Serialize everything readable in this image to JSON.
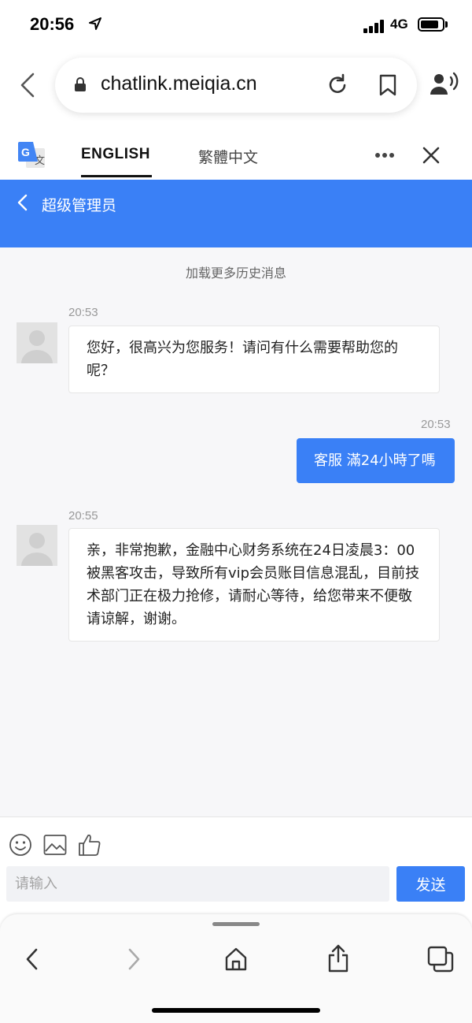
{
  "status_bar": {
    "time": "20:56",
    "network": "4G",
    "icons": [
      "location-arrow-icon",
      "signal-icon",
      "battery-icon"
    ]
  },
  "browser": {
    "url": "chatlink.meiqia.cn",
    "icons": [
      "back-icon",
      "lock-icon",
      "reload-icon",
      "bookmark-icon",
      "reader-voice-icon"
    ]
  },
  "translate_bar": {
    "tabs": [
      {
        "label": "ENGLISH",
        "active": true
      },
      {
        "label": "繁體中文",
        "active": false
      }
    ],
    "icons": [
      "google-translate-icon",
      "more-icon",
      "close-icon"
    ]
  },
  "chat_header": {
    "title": "超级管理员",
    "background": "#3a80f6"
  },
  "chat": {
    "load_more": "加载更多历史消息",
    "messages": [
      {
        "direction": "in",
        "time": "20:53",
        "text": "您好，很高兴为您服务！请问有什么需要帮助您的呢？"
      },
      {
        "direction": "out",
        "time": "20:53",
        "text": "客服 滿24小時了嗎"
      },
      {
        "direction": "in",
        "time": "20:55",
        "text": "亲，非常抱歉，金融中心财务系统在24日凌晨3：00被黑客攻击，导致所有vip会员账目信息混乱，目前技术部门正在极力抢修，请耐心等待，给您带来不便敬请谅解，谢谢。"
      }
    ]
  },
  "composer": {
    "placeholder": "请输入",
    "send_label": "发送",
    "icons": [
      "emoji-icon",
      "image-icon",
      "thumbs-up-icon"
    ]
  },
  "bottom_toolbar": {
    "icons": [
      "back-icon",
      "forward-icon",
      "home-icon",
      "share-icon",
      "tabs-icon"
    ]
  },
  "colors": {
    "accent": "#3a80f6",
    "chat_background": "#f7f7f9"
  }
}
